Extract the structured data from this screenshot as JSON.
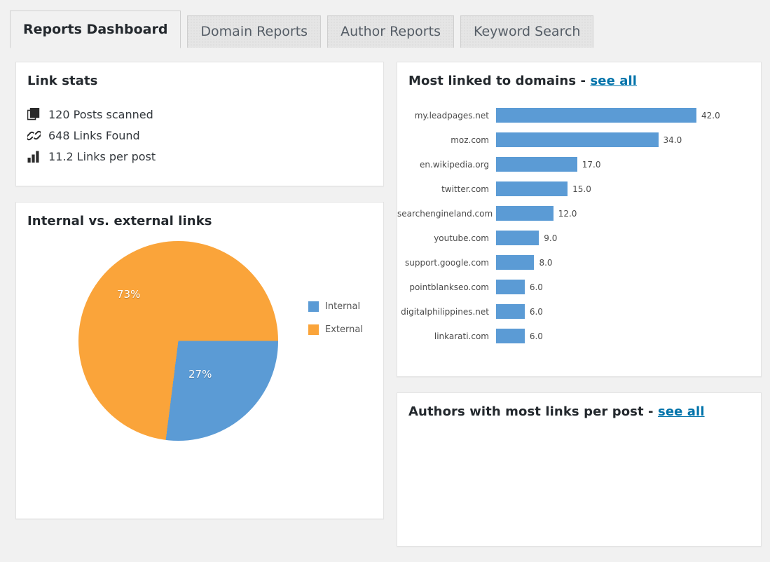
{
  "colors": {
    "accent_blue": "#5b9bd5",
    "accent_orange": "#faa43a",
    "link_blue": "#0073aa",
    "page_bg": "#f1f1f1",
    "panel_bg": "#ffffff"
  },
  "tabs": [
    {
      "label": "Reports Dashboard",
      "active": true
    },
    {
      "label": "Domain Reports",
      "active": false
    },
    {
      "label": "Author Reports",
      "active": false
    },
    {
      "label": "Keyword Search",
      "active": false
    }
  ],
  "link_stats": {
    "title": "Link stats",
    "rows": [
      {
        "icon": "posts-icon",
        "text": "120 Posts scanned",
        "value": 120,
        "unit": "Posts scanned"
      },
      {
        "icon": "link-chain-icon",
        "text": "648 Links Found",
        "value": 648,
        "unit": "Links Found"
      },
      {
        "icon": "bar-chart-icon",
        "text": "11.2 Links per post",
        "value": 11.2,
        "unit": "Links per post"
      }
    ]
  },
  "pie_panel": {
    "title": "Internal vs. external links"
  },
  "domains_panel": {
    "title_prefix": "Most linked to domains - ",
    "see_all_label": "see all"
  },
  "authors_panel": {
    "title_prefix": "Authors with most links per post - ",
    "see_all_label": "see all"
  },
  "chart_data": [
    {
      "type": "pie",
      "title": "Internal vs. external links",
      "legend_position": "right",
      "start_angle_deg": 90,
      "direction": "clockwise",
      "slices": [
        {
          "name": "Internal",
          "value": 27,
          "label": "27%",
          "color": "#5b9bd5"
        },
        {
          "name": "External",
          "value": 73,
          "label": "73%",
          "color": "#faa43a"
        }
      ],
      "legend": [
        "Internal",
        "External"
      ]
    },
    {
      "type": "bar",
      "orientation": "horizontal",
      "title": "Most linked to domains",
      "xlabel": "",
      "ylabel": "",
      "xlim": [
        0,
        42
      ],
      "grid": false,
      "bar_color": "#5b9bd5",
      "categories": [
        "my.leadpages.net",
        "moz.com",
        "en.wikipedia.org",
        "twitter.com",
        "searchengineland.com",
        "youtube.com",
        "support.google.com",
        "pointblankseo.com",
        "digitalphilippines.net",
        "linkarati.com"
      ],
      "values": [
        42.0,
        34.0,
        17.0,
        15.0,
        12.0,
        9.0,
        8.0,
        6.0,
        6.0,
        6.0
      ],
      "value_labels": [
        "42.0",
        "34.0",
        "17.0",
        "15.0",
        "12.0",
        "9.0",
        "8.0",
        "6.0",
        "6.0",
        "6.0"
      ]
    },
    {
      "type": "bar",
      "title": "Authors with most links per post",
      "categories": [],
      "values": [],
      "note": "empty"
    }
  ]
}
